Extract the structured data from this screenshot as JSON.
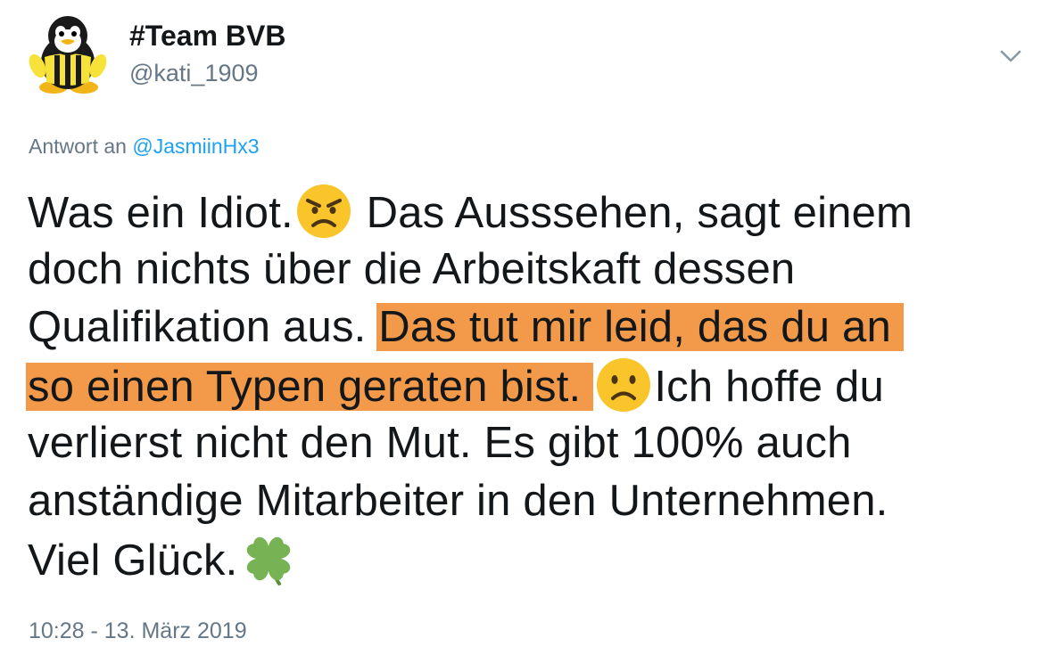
{
  "header": {
    "display_name": "#Team BVB",
    "handle": "@kati_1909",
    "avatar_icon": "penguin-bvb-avatar",
    "menu_icon": "chevron-down-icon"
  },
  "reply": {
    "prefix": "Antwort an",
    "mention": "@JasmiinHx3"
  },
  "tweet": {
    "line1_text": "Was ein Idiot.",
    "line1_after": "Das Ausssehen, sagt einem",
    "line2": "doch nichts über die Arbeitskaft dessen",
    "line3_plain": "Qualifikation aus. ",
    "line3_highlight": "Das tut mir leid, das du an",
    "line4_highlight": "so einen Typen geraten bist.",
    "line4_after": "Ich hoffe du",
    "line5": "verlierst nicht den Mut. Es gibt 100% auch",
    "line6": "anständige Mitarbeiter in den Unternehmen.",
    "line7": "Viel Glück.",
    "emojis": [
      "angry-face",
      "slightly-frowning-face",
      "four-leaf-clover"
    ]
  },
  "highlight_color": "#f29a4a",
  "accent_color": "#1da1f2",
  "timestamp": "10:28 - 13. März 2019"
}
